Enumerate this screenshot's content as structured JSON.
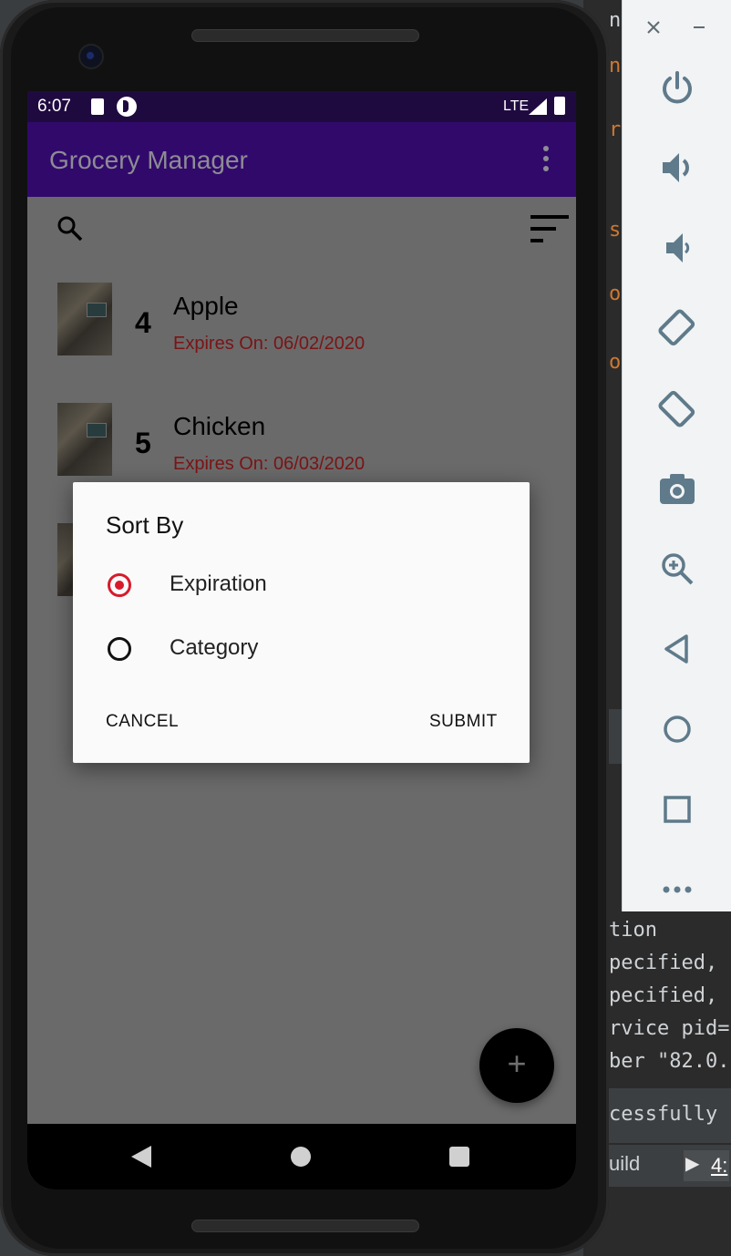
{
  "status_bar": {
    "time": "6:07",
    "network": "LTE"
  },
  "app_bar": {
    "title": "Grocery Manager"
  },
  "toolbar": {
    "search_icon": "search-icon",
    "sort_icon": "sort-icon"
  },
  "items": [
    {
      "quantity": "4",
      "name": "Apple",
      "expires": "Expires On: 06/02/2020"
    },
    {
      "quantity": "5",
      "name": "Chicken",
      "expires": "Expires On: 06/03/2020"
    }
  ],
  "dialog": {
    "title": "Sort By",
    "options": [
      {
        "label": "Expiration",
        "selected": true
      },
      {
        "label": "Category",
        "selected": false
      }
    ],
    "cancel_label": "CANCEL",
    "submit_label": "SUBMIT"
  },
  "fab": {
    "label": "+"
  },
  "emulator_panel": {
    "window_controls": [
      "close-icon",
      "minimize-icon"
    ],
    "controls": [
      "power-icon",
      "volume-up-icon",
      "volume-down-icon",
      "rotate-left-icon",
      "rotate-right-icon",
      "camera-icon",
      "zoom-icon",
      "back-icon",
      "home-icon",
      "overview-icon",
      "more-icon"
    ]
  },
  "background_ide": {
    "lines": [
      "nf",
      "ng",
      "rt",
      "s",
      "or",
      "o",
      "tion",
      "pecified,",
      "pecified,",
      "rvice pid=",
      "ber \"82.0.",
      "cessfully f"
    ],
    "tab_build": "uild",
    "tab_run_number": "4:"
  },
  "colors": {
    "app_bar": "#31096b",
    "status_bar": "#1f0a40",
    "accent_radio": "#d81b2c",
    "expiry_text": "#7a1416"
  }
}
